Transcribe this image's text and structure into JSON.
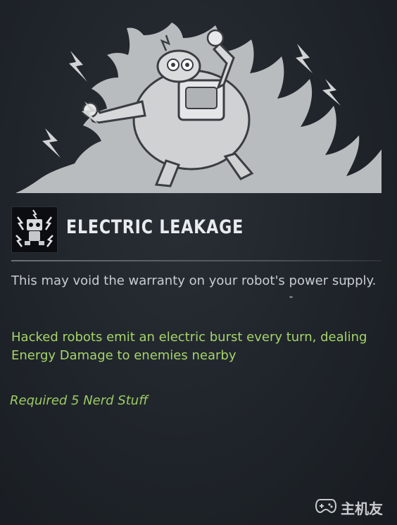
{
  "ability": {
    "title": "ELECTRIC LEAKAGE",
    "icon": "robot-electric-icon",
    "flavor_text": "This may void the warranty on your robot's power supply.",
    "effect_text": "Hacked robots emit an electric burst every turn, dealing Energy Damage to enemies nearby",
    "requirement": "Required 5 Nerd Stuff"
  },
  "watermark": {
    "text": "主机友",
    "icon": "gamepad-icon"
  },
  "colors": {
    "background": "#1f242a",
    "title": "#e9ecef",
    "flavor": "#c9ccd0",
    "effect": "#a6d46a",
    "requirement": "#9ccb63",
    "illustration_fill": "#b9bcbf"
  }
}
